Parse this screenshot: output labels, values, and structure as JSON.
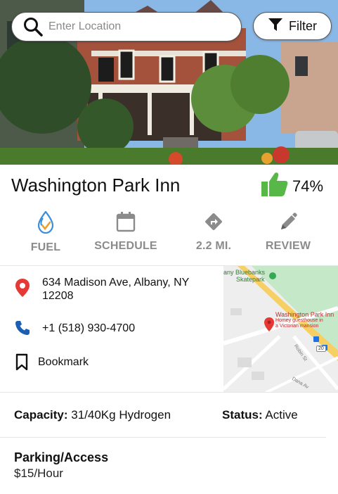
{
  "search": {
    "placeholder": "Enter Location"
  },
  "filter": {
    "label": "Filter"
  },
  "place": {
    "name": "Washington Park Inn",
    "rating_pct": "74%"
  },
  "actions": [
    {
      "label": "FUEL",
      "icon": "fuel-drop-icon"
    },
    {
      "label": "SCHEDULE",
      "icon": "calendar-icon"
    },
    {
      "label": "2.2 MI.",
      "icon": "directions-icon"
    },
    {
      "label": "REVIEW",
      "icon": "pencil-icon"
    }
  ],
  "info": {
    "address": "634 Madison Ave, Albany, NY 12208",
    "phone": "+1 (518) 930-4700",
    "bookmark": "Bookmark"
  },
  "map": {
    "place_label": "Washington Park Inn",
    "place_sub_1": "Homey guesthouse in",
    "place_sub_2": "a Victorian mansion",
    "park_label_1": "any Bluebanks",
    "park_label_2": "Skatepark",
    "street_1": "Robin St",
    "street_2": "Dana Av",
    "route_no": "20"
  },
  "details": {
    "capacity_label": "Capacity:",
    "capacity_value": "31/40Kg Hydrogen",
    "status_label": "Status:",
    "status_value": "Active",
    "parking_label": "Parking/Access",
    "parking_value": "$15/Hour"
  },
  "colors": {
    "accent_red": "#e53935",
    "thumb_green": "#57b847",
    "phone_blue": "#1a5fb4",
    "muted_gray": "#8b8b8b"
  }
}
